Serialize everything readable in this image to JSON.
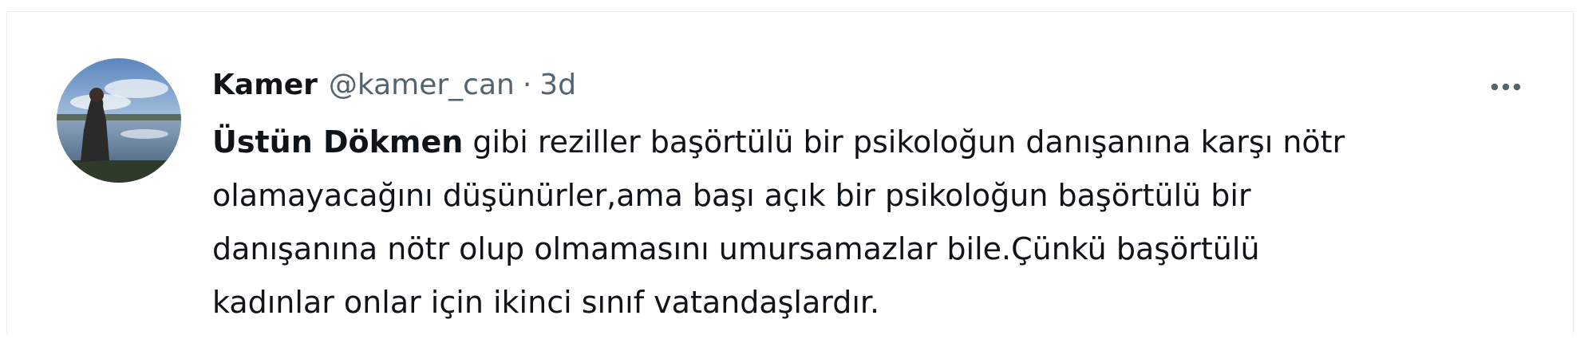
{
  "tweet": {
    "author": {
      "display_name": "Kamer",
      "handle": "@kamer_can",
      "avatar_icon": "profile-photo"
    },
    "separator": "·",
    "timestamp": "3d",
    "more_icon": "more-horizontal-icon",
    "body": {
      "highlighted": "Üstün Dökmen",
      "line1_rest": " gibi reziller başörtülü bir psikoloğun danışanına karşı nötr",
      "line2": "olamayacağını düşünürler,ama başı açık bir psikoloğun başörtülü bir",
      "line3": "danışanına nötr olup olmamasını umursamazlar bile.Çünkü başörtülü",
      "line4": "kadınlar onlar için ikinci sınıf vatandaşlardır."
    }
  },
  "colors": {
    "text_primary": "#0f1419",
    "text_secondary": "#536471",
    "border": "#e6ecf0",
    "background": "#ffffff"
  }
}
